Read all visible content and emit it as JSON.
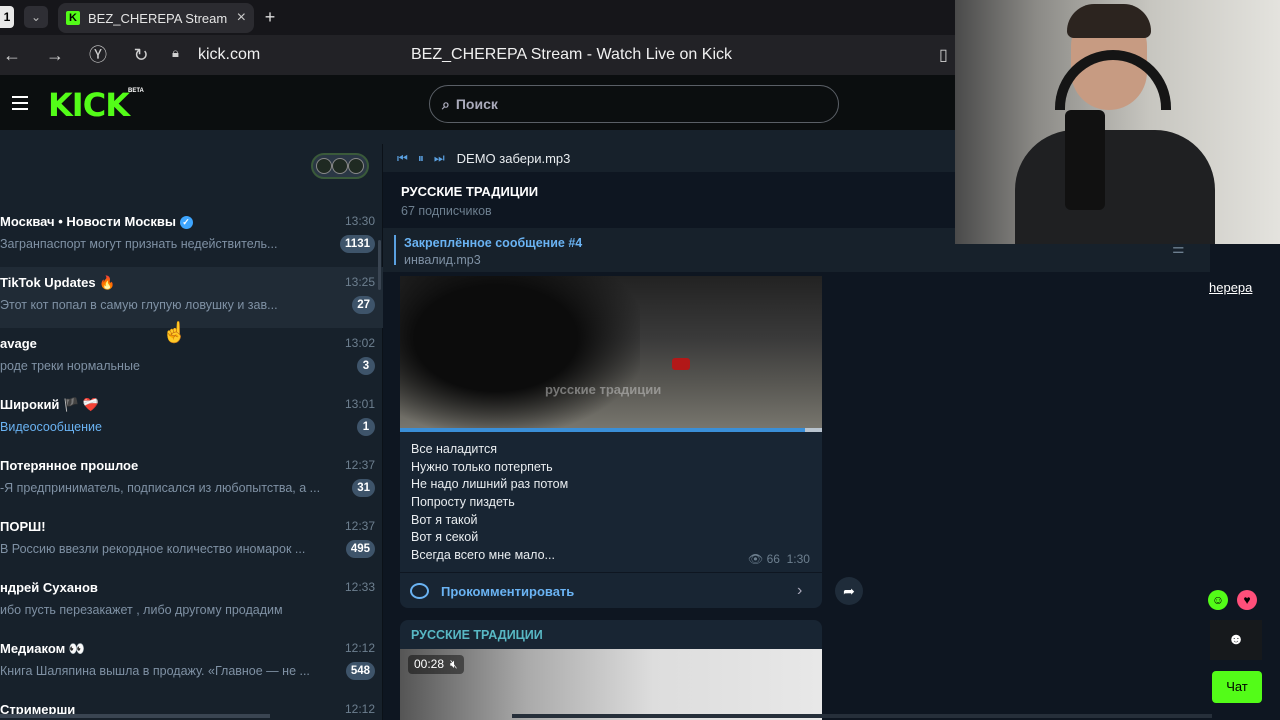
{
  "browser": {
    "tab_index": "1",
    "tab_title": "BEZ_CHEREPA Stream",
    "url": "kick.com",
    "page_title": "BEZ_CHEREPA Stream - Watch Live on Kick"
  },
  "kick": {
    "logo": "KICK",
    "beta": "BETA",
    "search_placeholder": "Поиск",
    "link_text": "hерера",
    "chat_button": "Чат"
  },
  "player": {
    "track": "DEMO забери.mp3"
  },
  "chats": [
    {
      "name": "Москвач • Новости Москвы",
      "time": "13:30",
      "preview": "Загранпаспорт могут признать недействитель...",
      "badge": "1131",
      "verified": true
    },
    {
      "name": "TikTok Updates 🔥",
      "time": "13:25",
      "preview": "Этот кот попал в самую глупую ловушку и зав...",
      "badge": "27"
    },
    {
      "name": "avage",
      "time": "13:02",
      "preview": "роде треки нормальные",
      "badge": "3"
    },
    {
      "name": "Широкий 🏴 ❤️‍🩹",
      "time": "13:01",
      "preview": "Видеосообщение",
      "badge": "1",
      "link": true
    },
    {
      "name": "Потерянное прошлое",
      "time": "12:37",
      "preview": "-Я предприниматель, подписался из любопытства, а ...",
      "badge": "31"
    },
    {
      "name": "ПОРШ!",
      "time": "12:37",
      "preview": "В Россию ввезли рекордное количество иномарок ...",
      "badge": "495"
    },
    {
      "name": "ндрей Суханов",
      "time": "12:33",
      "preview": "ибо пусть перезакажет , либо другому продадим",
      "badge": ""
    },
    {
      "name": "Медиаком 👀",
      "time": "12:12",
      "preview": "Книга Шаляпина вышла в продажу. «Главное — не ...",
      "badge": "548"
    },
    {
      "name": "Стримерши",
      "time": "12:12",
      "preview": "",
      "badge": ""
    }
  ],
  "channel": {
    "title": "РУССКИЕ ТРАДИЦИИ",
    "subscribers": "67 подписчиков",
    "pinned_title": "Закреплённое сообщение #4",
    "pinned_text": "инвалид.mp3",
    "watermark": "русские традиции",
    "lyrics": [
      "Все наладится",
      "Нужно только потерпеть",
      "Не надо лишний раз потом",
      "Попросту пиздеть",
      "Вот я такой",
      "Вот я секой",
      "Всегда всего мне мало..."
    ],
    "views": "66",
    "post_time": "1:30",
    "comment_label": "Прокомментировать",
    "post2_title": "РУССКИЕ ТРАДИЦИИ",
    "video2_time": "00:28"
  }
}
